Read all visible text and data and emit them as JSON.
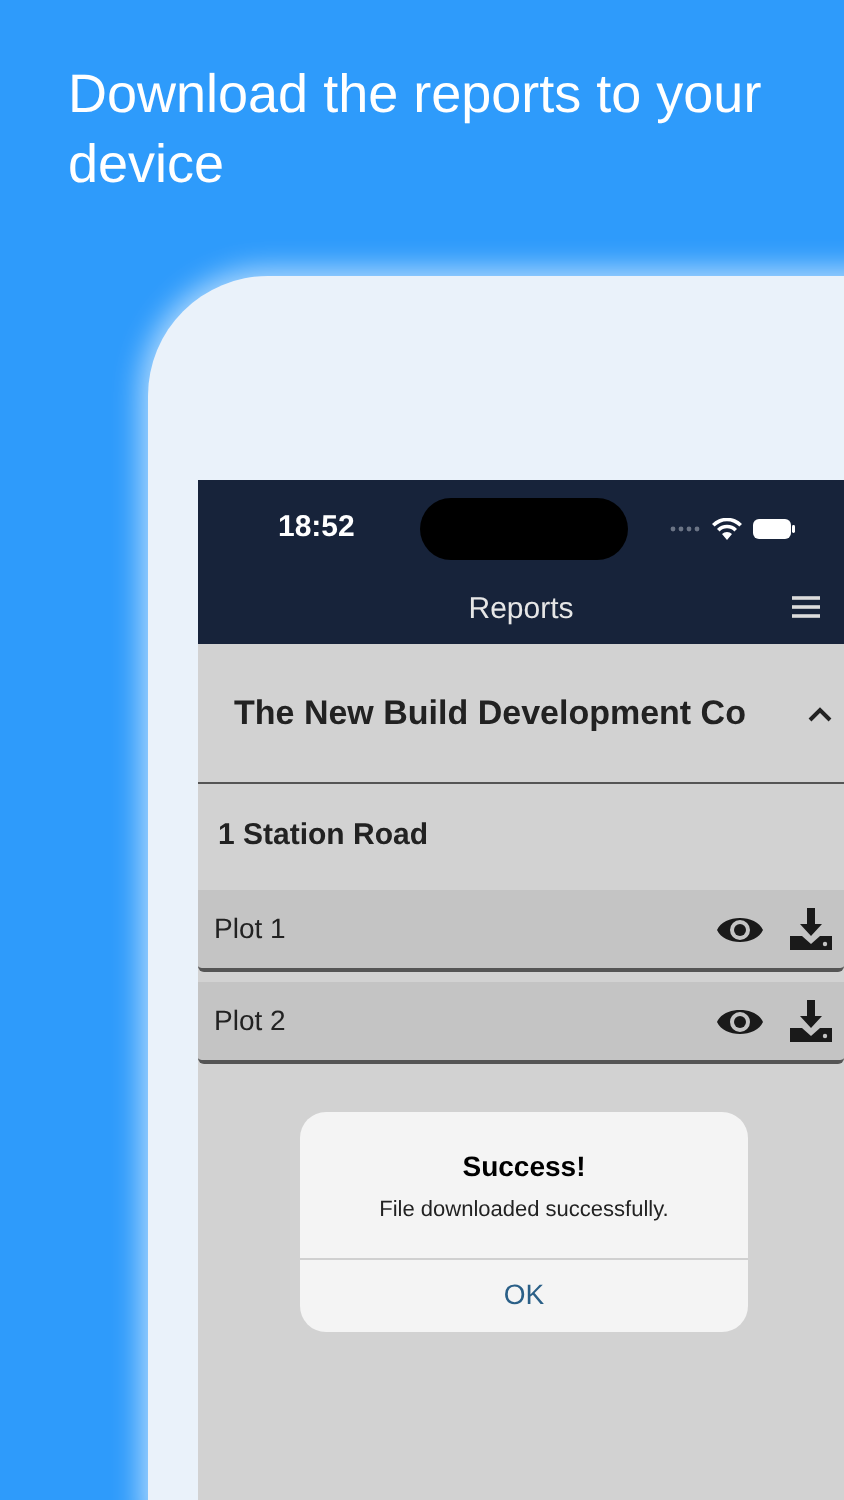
{
  "headline": "Download the reports to your device",
  "status_bar": {
    "time": "18:52"
  },
  "nav": {
    "title": "Reports"
  },
  "company": {
    "name": "The New Build Development Co",
    "expanded": true
  },
  "site": {
    "name": "1 Station Road"
  },
  "plots": [
    {
      "label": "Plot 1"
    },
    {
      "label": "Plot 2"
    }
  ],
  "alert": {
    "title": "Success!",
    "message": "File downloaded successfully.",
    "button": "OK"
  }
}
